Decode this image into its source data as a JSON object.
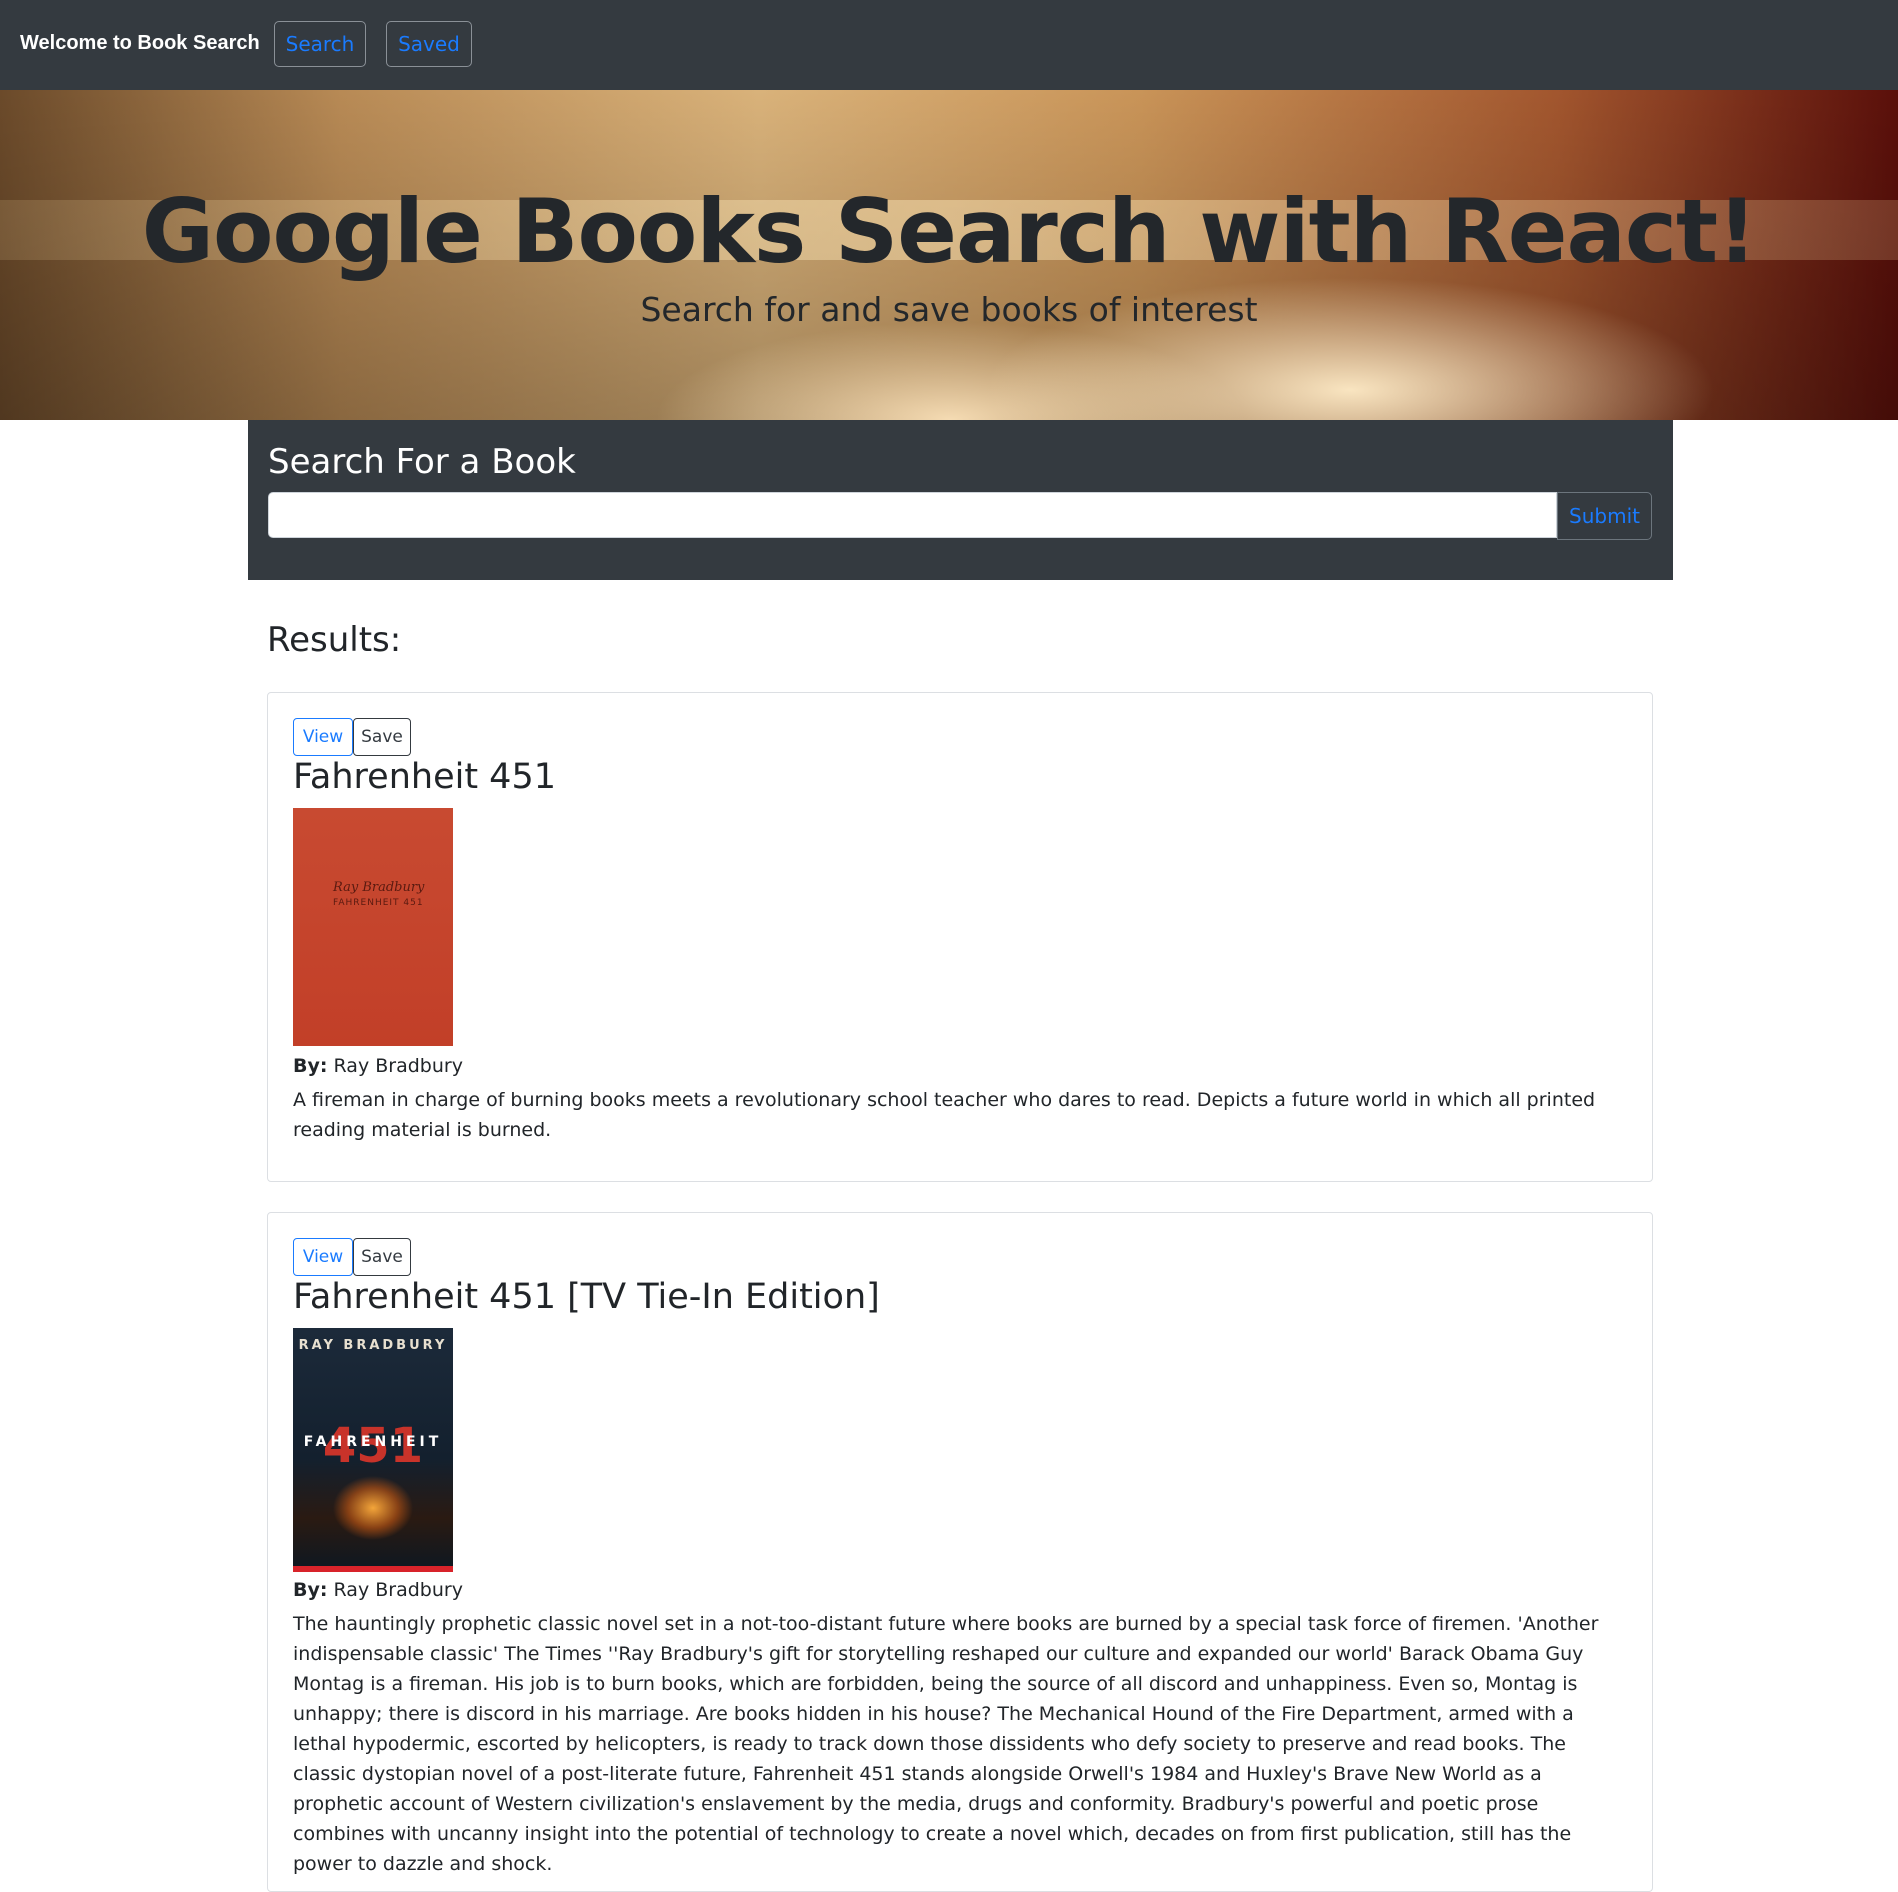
{
  "navbar": {
    "brand": "Welcome to Book Search",
    "search_label": "Search",
    "saved_label": "Saved"
  },
  "hero": {
    "title": "Google Books Search with React!",
    "subtitle": "Search for and save books of interest"
  },
  "search": {
    "heading": "Search For a Book",
    "input_value": "",
    "submit_label": "Submit"
  },
  "results": {
    "heading": "Results:",
    "items": [
      {
        "view_label": "View",
        "save_label": "Save",
        "title": "Fahrenheit 451",
        "by_label": "By:",
        "author": "Ray Bradbury",
        "cover": {
          "author_text": "Ray Bradbury",
          "title_text": "FAHRENHEIT 451",
          "color": "#c84a31"
        },
        "description": "A fireman in charge of burning books meets a revolutionary school teacher who dares to read. Depicts a future world in which all printed reading material is burned."
      },
      {
        "view_label": "View",
        "save_label": "Save",
        "title": "Fahrenheit 451 [TV Tie-In Edition]",
        "by_label": "By:",
        "author": "Ray Bradbury",
        "cover": {
          "author_text": "RAY BRADBURY",
          "number_text": "451",
          "title_text": "FAHRENHEIT",
          "color": "#13202e"
        },
        "description": "The hauntingly prophetic classic novel set in a not-too-distant future where books are burned by a special task force of firemen. 'Another indispensable classic' The Times ''Ray Bradbury's gift for storytelling reshaped our culture and expanded our world' Barack Obama Guy Montag is a fireman. His job is to burn books, which are forbidden, being the source of all discord and unhappiness. Even so, Montag is unhappy; there is discord in his marriage. Are books hidden in his house? The Mechanical Hound of the Fire Department, armed with a lethal hypodermic, escorted by helicopters, is ready to track down those dissidents who defy society to preserve and read books. The classic dystopian novel of a post-literate future, Fahrenheit 451 stands alongside Orwell's 1984 and Huxley's Brave New World as a prophetic account of Western civilization's enslavement by the media, drugs and conformity. Bradbury's powerful and poetic prose combines with uncanny insight into the potential of technology to create a novel which, decades on from first publication, still has the power to dazzle and shock."
      }
    ]
  },
  "colors": {
    "navbar_bg": "#343a40",
    "link_blue": "#1a7bff"
  }
}
